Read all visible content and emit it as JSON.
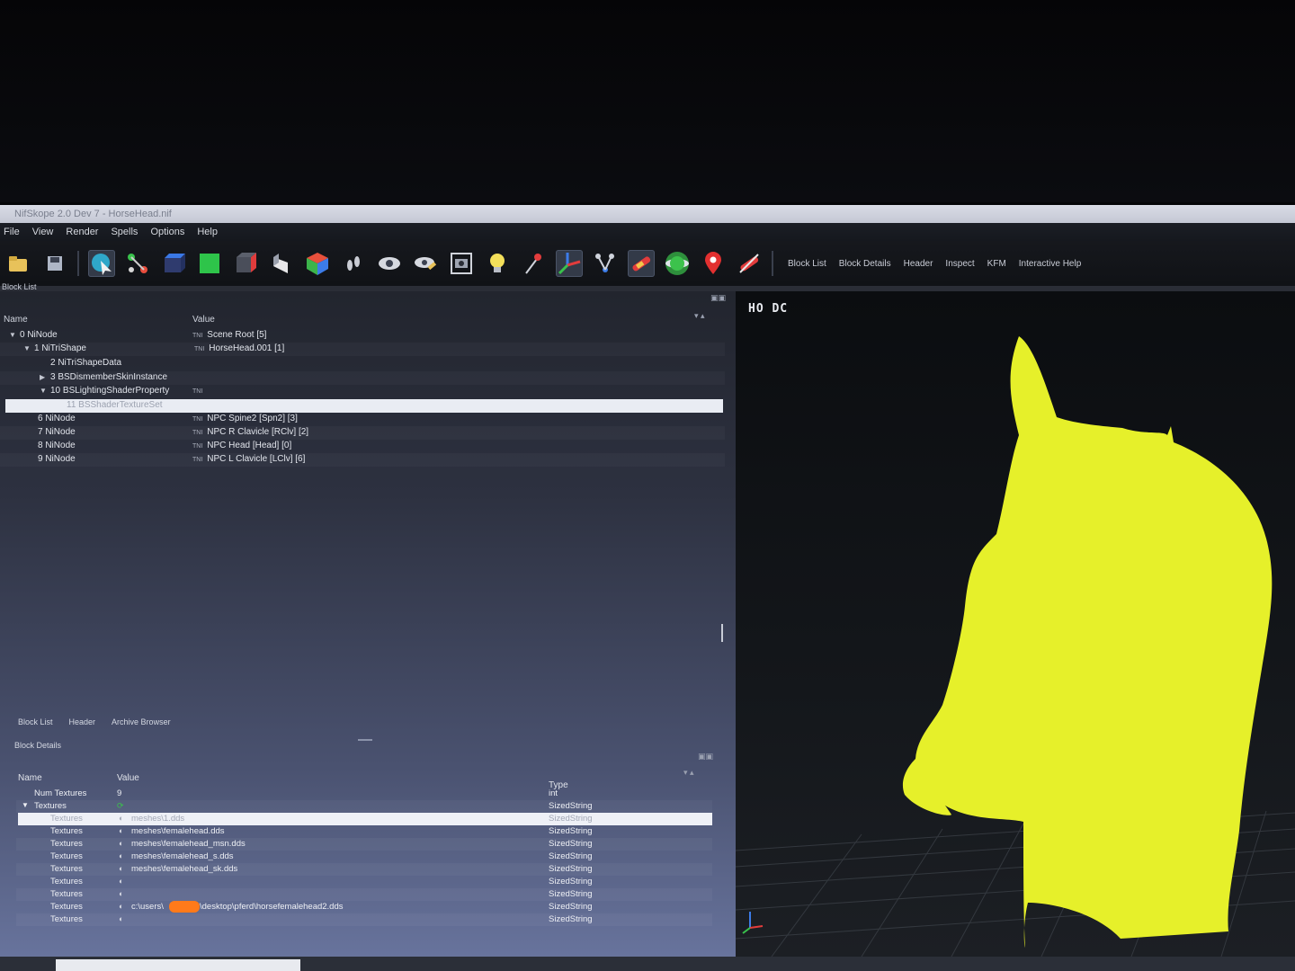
{
  "window": {
    "title": "NifSkope 2.0 Dev 7 - HorseHead.nif"
  },
  "menu": [
    "File",
    "View",
    "Render",
    "Spells",
    "Options",
    "Help"
  ],
  "toolbar": {
    "icons": [
      "load-icon",
      "save-icon",
      "select-icon",
      "connect-icon",
      "box-blue-icon",
      "box-green-icon",
      "box-red-icon",
      "plane-icon",
      "cube-color-icon",
      "footprints-icon",
      "eye-icon",
      "eye-pen-icon",
      "screenshot-icon",
      "lightbulb-icon",
      "pin-icon",
      "axes-icon",
      "skeleton-icon",
      "bone-icon",
      "sphere-icon",
      "marker-icon",
      "no-draw-icon"
    ],
    "tabs": [
      "Block List",
      "Block Details",
      "Header",
      "Inspect",
      "KFM",
      "Interactive Help"
    ]
  },
  "block_list": {
    "label": "Block List",
    "columns": {
      "name": "Name",
      "value": "Value"
    },
    "rows": [
      {
        "name": "0 NiNode",
        "value": "Scene Root [5]",
        "tag": "TNI"
      },
      {
        "name": "1 NiTriShape",
        "value": "HorseHead.001 [1]",
        "tag": "TNI"
      },
      {
        "name": "2 NiTriShapeData",
        "value": "",
        "tag": ""
      },
      {
        "name": "3 BSDismemberSkinInstance",
        "value": "",
        "tag": ""
      },
      {
        "name": "10 BSLightingShaderProperty",
        "value": "",
        "tag": "TNI"
      },
      {
        "name": "11 BSShaderTextureSet",
        "value": "",
        "tag": ""
      },
      {
        "name": "6 NiNode",
        "value": "NPC Spine2 [Spn2] [3]",
        "tag": "TNI"
      },
      {
        "name": "7 NiNode",
        "value": "NPC R Clavicle [RClv] [2]",
        "tag": "TNI"
      },
      {
        "name": "8 NiNode",
        "value": "NPC Head [Head] [0]",
        "tag": "TNI"
      },
      {
        "name": "9 NiNode",
        "value": "NPC L Clavicle [LClv] [6]",
        "tag": "TNI"
      }
    ]
  },
  "bottom_tabs": [
    "Block List",
    "Header",
    "Archive Browser"
  ],
  "block_details": {
    "label": "Block Details",
    "columns": {
      "name": "Name",
      "value": "Value",
      "type": "Type"
    },
    "rows": [
      {
        "name": "Num Textures",
        "value": "9",
        "type": "int"
      },
      {
        "name": "Textures",
        "value": "",
        "type": "SizedString"
      },
      {
        "name": "Textures",
        "value": "meshes\\1.dds",
        "type": "SizedString"
      },
      {
        "name": "Textures",
        "value": "meshes\\femalehead.dds",
        "type": "SizedString"
      },
      {
        "name": "Textures",
        "value": "meshes\\femalehead_msn.dds",
        "type": "SizedString"
      },
      {
        "name": "Textures",
        "value": "meshes\\femalehead_s.dds",
        "type": "SizedString"
      },
      {
        "name": "Textures",
        "value": "meshes\\femalehead_sk.dds",
        "type": "SizedString"
      },
      {
        "name": "Textures",
        "value": "",
        "type": "SizedString"
      },
      {
        "name": "Textures",
        "value": "",
        "type": "SizedString"
      },
      {
        "name": "Textures",
        "value": "c:\\users\\",
        "value2": "\\desktop\\pferd\\horsefemalehead2.dds",
        "type": "SizedString"
      },
      {
        "name": "Textures",
        "value": "",
        "type": "SizedString"
      }
    ]
  },
  "viewport": {
    "label": "HO DC",
    "mesh_color": "#e6f02a"
  },
  "colors": {
    "accent": "#e6f02a",
    "redaction": "#ff7a1a",
    "selection": "#e9ecf3"
  }
}
